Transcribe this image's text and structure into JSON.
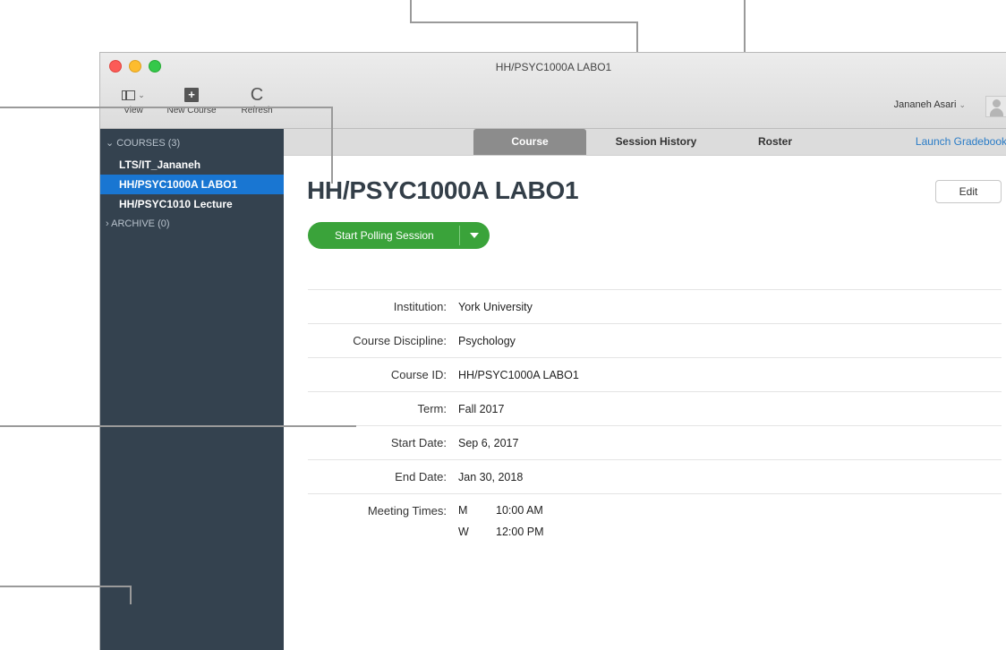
{
  "window": {
    "title": "HH/PSYC1000A LABO1"
  },
  "toolbar": {
    "view_label": "View",
    "new_course_label": "New Course",
    "refresh_label": "Refresh",
    "new_course_glyph": "+",
    "refresh_glyph": "C",
    "chevron": "⌄"
  },
  "user": {
    "name": "Jananeh Asari",
    "chevron": "⌄"
  },
  "sidebar": {
    "courses_header": "COURSES (3)",
    "courses_header_chevron": "⌄",
    "items": [
      {
        "label": "LTS/IT_Jananeh"
      },
      {
        "label": "HH/PSYC1000A LABO1",
        "active": true
      },
      {
        "label": "HH/PSYC1010 Lecture"
      }
    ],
    "archive_header": "ARCHIVE (0)",
    "archive_header_chevron": "›"
  },
  "tabs": {
    "course": "Course",
    "session_history": "Session History",
    "roster": "Roster",
    "launch_gradebook": "Launch Gradebook"
  },
  "main": {
    "title": "HH/PSYC1000A LABO1",
    "edit_label": "Edit",
    "start_polling_label": "Start Polling Session"
  },
  "details": {
    "institution_label": "Institution:",
    "institution": "York University",
    "discipline_label": "Course Discipline:",
    "discipline": "Psychology",
    "course_id_label": "Course ID:",
    "course_id": "HH/PSYC1000A LABO1",
    "term_label": "Term:",
    "term": "Fall 2017",
    "start_date_label": "Start Date:",
    "start_date": "Sep 6, 2017",
    "end_date_label": "End Date:",
    "end_date": "Jan 30, 2018",
    "meeting_label": "Meeting Times:",
    "meetings": [
      {
        "day": "M",
        "time": "10:00 AM"
      },
      {
        "day": "W",
        "time": "12:00 PM"
      }
    ]
  },
  "colors": {
    "sidebar_bg": "#34424f",
    "sidebar_active": "#1976d2",
    "poll_button": "#3aa33a",
    "link": "#2a7cc7"
  }
}
